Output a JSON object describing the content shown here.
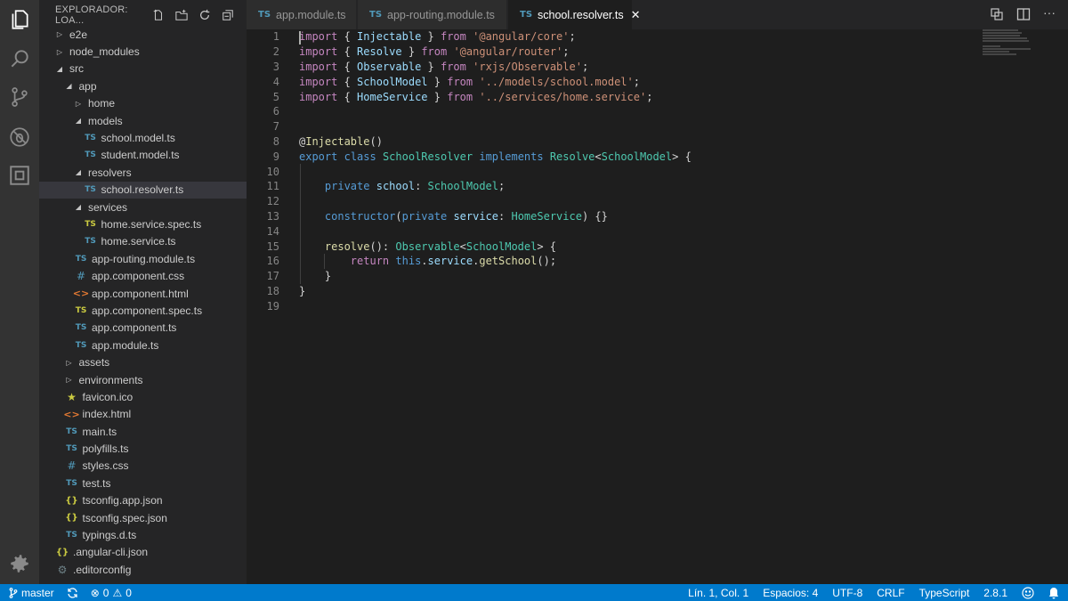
{
  "sidebar": {
    "header_title": "EXPLORADOR: LOA...",
    "tree": [
      {
        "label": "e2e",
        "type": "folder",
        "expanded": false
      },
      {
        "label": "node_modules",
        "type": "folder",
        "expanded": false
      },
      {
        "label": "src",
        "type": "folder",
        "expanded": true
      },
      {
        "label": "app",
        "type": "folder",
        "expanded": true
      },
      {
        "label": "home",
        "type": "folder",
        "expanded": false
      },
      {
        "label": "models",
        "type": "folder",
        "expanded": true
      },
      {
        "label": "school.model.ts",
        "type": "ts"
      },
      {
        "label": "student.model.ts",
        "type": "ts"
      },
      {
        "label": "resolvers",
        "type": "folder",
        "expanded": true
      },
      {
        "label": "school.resolver.ts",
        "type": "ts",
        "selected": true
      },
      {
        "label": "services",
        "type": "folder",
        "expanded": true
      },
      {
        "label": "home.service.spec.ts",
        "type": "ts-spec"
      },
      {
        "label": "home.service.ts",
        "type": "ts"
      },
      {
        "label": "app-routing.module.ts",
        "type": "ts"
      },
      {
        "label": "app.component.css",
        "type": "css"
      },
      {
        "label": "app.component.html",
        "type": "html"
      },
      {
        "label": "app.component.spec.ts",
        "type": "ts-spec"
      },
      {
        "label": "app.component.ts",
        "type": "ts"
      },
      {
        "label": "app.module.ts",
        "type": "ts"
      },
      {
        "label": "assets",
        "type": "folder",
        "expanded": false
      },
      {
        "label": "environments",
        "type": "folder",
        "expanded": false
      },
      {
        "label": "favicon.ico",
        "type": "ico"
      },
      {
        "label": "index.html",
        "type": "html"
      },
      {
        "label": "main.ts",
        "type": "ts"
      },
      {
        "label": "polyfills.ts",
        "type": "ts"
      },
      {
        "label": "styles.css",
        "type": "css"
      },
      {
        "label": "test.ts",
        "type": "ts"
      },
      {
        "label": "tsconfig.app.json",
        "type": "json"
      },
      {
        "label": "tsconfig.spec.json",
        "type": "json"
      },
      {
        "label": "typings.d.ts",
        "type": "ts"
      },
      {
        "label": ".angular-cli.json",
        "type": "json"
      },
      {
        "label": ".editorconfig",
        "type": "config"
      }
    ]
  },
  "tabs": [
    {
      "label": "app.module.ts",
      "icon": "TS",
      "active": false
    },
    {
      "label": "app-routing.module.ts",
      "icon": "TS",
      "active": false
    },
    {
      "label": "school.resolver.ts",
      "icon": "TS",
      "active": true
    }
  ],
  "editor": {
    "lines": [
      [
        [
          "kw",
          "import"
        ],
        [
          "pl",
          " { "
        ],
        [
          "id",
          "Injectable"
        ],
        [
          "pl",
          " } "
        ],
        [
          "kw",
          "from"
        ],
        [
          "pl",
          " "
        ],
        [
          "str",
          "'@angular/core'"
        ],
        [
          "pl",
          ";"
        ]
      ],
      [
        [
          "kw",
          "import"
        ],
        [
          "pl",
          " { "
        ],
        [
          "id",
          "Resolve"
        ],
        [
          "pl",
          " } "
        ],
        [
          "kw",
          "from"
        ],
        [
          "pl",
          " "
        ],
        [
          "str",
          "'@angular/router'"
        ],
        [
          "pl",
          ";"
        ]
      ],
      [
        [
          "kw",
          "import"
        ],
        [
          "pl",
          " { "
        ],
        [
          "id",
          "Observable"
        ],
        [
          "pl",
          " } "
        ],
        [
          "kw",
          "from"
        ],
        [
          "pl",
          " "
        ],
        [
          "str",
          "'rxjs/Observable'"
        ],
        [
          "pl",
          ";"
        ]
      ],
      [
        [
          "kw",
          "import"
        ],
        [
          "pl",
          " { "
        ],
        [
          "id",
          "SchoolModel"
        ],
        [
          "pl",
          " } "
        ],
        [
          "kw",
          "from"
        ],
        [
          "pl",
          " "
        ],
        [
          "str",
          "'../models/school.model'"
        ],
        [
          "pl",
          ";"
        ]
      ],
      [
        [
          "kw",
          "import"
        ],
        [
          "pl",
          " { "
        ],
        [
          "id",
          "HomeService"
        ],
        [
          "pl",
          " } "
        ],
        [
          "kw",
          "from"
        ],
        [
          "pl",
          " "
        ],
        [
          "str",
          "'../services/home.service'"
        ],
        [
          "pl",
          ";"
        ]
      ],
      [],
      [],
      [
        [
          "pl",
          "@"
        ],
        [
          "fn",
          "Injectable"
        ],
        [
          "pl",
          "()"
        ]
      ],
      [
        [
          "kw2",
          "export"
        ],
        [
          "pl",
          " "
        ],
        [
          "kw2",
          "class"
        ],
        [
          "pl",
          " "
        ],
        [
          "ty",
          "SchoolResolver"
        ],
        [
          "pl",
          " "
        ],
        [
          "kw2",
          "implements"
        ],
        [
          "pl",
          " "
        ],
        [
          "ty",
          "Resolve"
        ],
        [
          "pl",
          "<"
        ],
        [
          "ty",
          "SchoolModel"
        ],
        [
          "pl",
          "> {"
        ]
      ],
      [],
      [
        [
          "pl",
          "    "
        ],
        [
          "kw2",
          "private"
        ],
        [
          "pl",
          " "
        ],
        [
          "id",
          "school"
        ],
        [
          "pl",
          ": "
        ],
        [
          "ty",
          "SchoolModel"
        ],
        [
          "pl",
          ";"
        ]
      ],
      [],
      [
        [
          "pl",
          "    "
        ],
        [
          "kw2",
          "constructor"
        ],
        [
          "pl",
          "("
        ],
        [
          "kw2",
          "private"
        ],
        [
          "pl",
          " "
        ],
        [
          "id",
          "service"
        ],
        [
          "pl",
          ": "
        ],
        [
          "ty",
          "HomeService"
        ],
        [
          "pl",
          ") {}"
        ]
      ],
      [],
      [
        [
          "pl",
          "    "
        ],
        [
          "fn",
          "resolve"
        ],
        [
          "pl",
          "(): "
        ],
        [
          "ty",
          "Observable"
        ],
        [
          "pl",
          "<"
        ],
        [
          "ty",
          "SchoolModel"
        ],
        [
          "pl",
          "> {"
        ]
      ],
      [
        [
          "pl",
          "        "
        ],
        [
          "kw",
          "return"
        ],
        [
          "pl",
          " "
        ],
        [
          "kw2",
          "this"
        ],
        [
          "pl",
          "."
        ],
        [
          "id",
          "service"
        ],
        [
          "pl",
          "."
        ],
        [
          "fn",
          "getSchool"
        ],
        [
          "pl",
          "();"
        ]
      ],
      [
        [
          "pl",
          "    }"
        ]
      ],
      [
        [
          "pl",
          "}"
        ]
      ],
      []
    ]
  },
  "statusbar": {
    "branch": "master",
    "errors": "0",
    "warnings": "0",
    "position": "Lín. 1, Col. 1",
    "indent": "Espacios: 4",
    "encoding": "UTF-8",
    "eol": "CRLF",
    "language": "TypeScript",
    "version": "2.8.1"
  },
  "colors": {
    "statusbar": "#007acc",
    "activity": "#333333",
    "sidebar": "#252526",
    "editor": "#1e1e1e"
  }
}
